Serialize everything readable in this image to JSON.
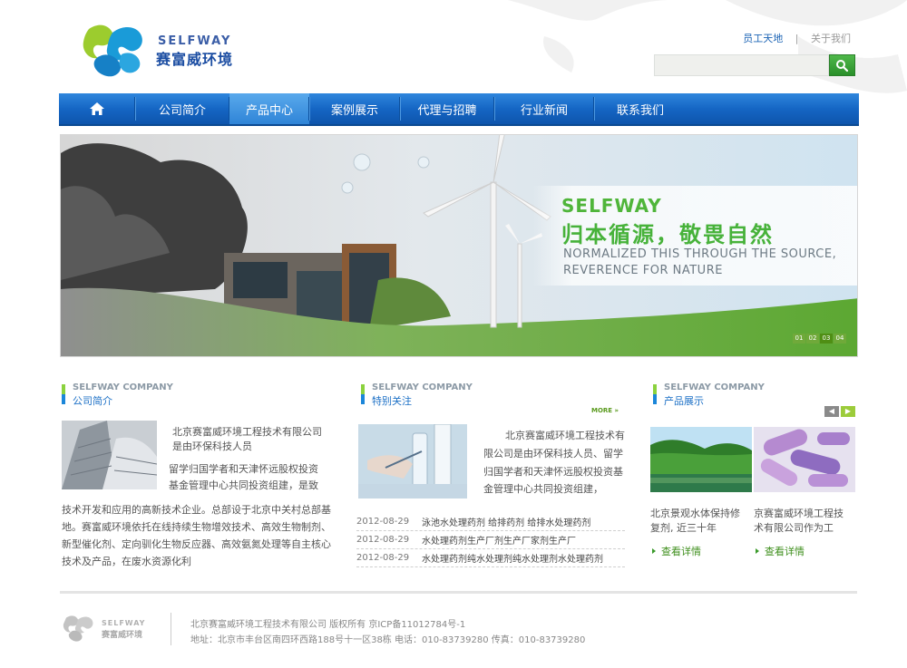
{
  "header": {
    "logo_en": "SELFWAY",
    "logo_cn": "赛富威环境",
    "links": [
      "员工天地",
      "关于我们"
    ],
    "separator": "|",
    "search_placeholder": ""
  },
  "nav": {
    "items": [
      {
        "label": "公司简介"
      },
      {
        "label": "产品中心"
      },
      {
        "label": "案例展示"
      },
      {
        "label": "代理与招聘"
      },
      {
        "label": "行业新闻"
      },
      {
        "label": "联系我们"
      }
    ],
    "active": "产品中心"
  },
  "banner": {
    "brand": "SELFWAY",
    "slogan": "归本循源，敬畏自然",
    "en_line1": "NORMALIZED THIS THROUGH THE SOURCE,",
    "en_line2": "REVERENCE FOR NATURE",
    "pager": [
      "01",
      "02",
      "03",
      "04"
    ],
    "pager_active": "03"
  },
  "about": {
    "en": "SELFWAY COMPANY",
    "cn": "公司简介",
    "line1": "北京赛富威环境工程技术有限公司",
    "line2": "是由环保科技人员",
    "line3": "留学归国学者和天津怀远股权投资",
    "line4": "基金管理中心共同投资组建，是致",
    "line5": "技术开发和应用的高新技术企业。总部设于北京中关村总部基",
    "line6": "地。赛富威环境依托在线持续生物增效技术、高效生物制剂、",
    "line7": "新型催化剂、定向驯化生物反应器、高效氨氮处理等自主核心",
    "line8": "技术及产品，在废水资源化利"
  },
  "focus": {
    "en": "SELFWAY COMPANY",
    "cn": "特别关注",
    "more": "MORE »",
    "line1": "北京赛富威环境工程技术有",
    "line2": "限公司是由环保科技人员、留学",
    "line3": "归国学者和天津怀远股权投资基",
    "line4": "金管理中心共同投资组建，",
    "news": [
      {
        "date": "2012-08-29",
        "title": "泳池水处理药剂 给排药剂 给排水处理药剂"
      },
      {
        "date": "2012-08-29",
        "title": "水处理药剂生产厂剂生产厂家剂生产厂"
      },
      {
        "date": "2012-08-29",
        "title": "水处理药剂纯水处理剂纯水处理剂水处理药剂"
      }
    ]
  },
  "products": {
    "en": "SELFWAY COMPANY",
    "cn": "产品展示",
    "prev": "◀",
    "next": "▶",
    "items": [
      {
        "line1": "北京景观水体保持修",
        "line2": "复剂, 近三十年",
        "detail": "查看详情"
      },
      {
        "line1": "京赛富威环境工程技",
        "line2": "术有限公司作为工",
        "detail": "查看详情"
      }
    ]
  },
  "footer": {
    "logo_en": "SELFWAY",
    "logo_cn": "赛富威环境",
    "line1": "北京赛富威环境工程技术有限公司  版权所有     京ICP备11012784号-1",
    "line2": "地址：北京市丰台区南四环西路188号十一区38栋    电话：010-83739280   传真：010-83739280"
  }
}
